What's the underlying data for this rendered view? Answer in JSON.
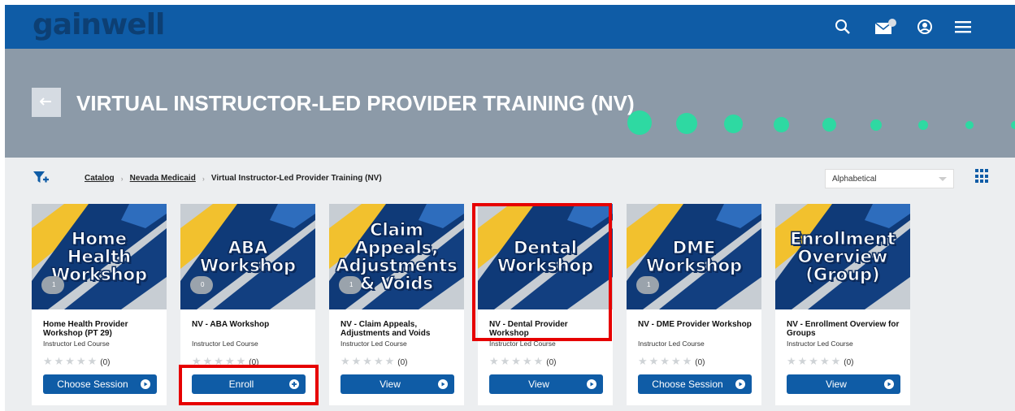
{
  "header": {
    "logo_text": "gainwell",
    "icons": [
      "search-icon",
      "messages-icon",
      "account-icon",
      "menu-icon"
    ],
    "brand_color": "#0f5ca6"
  },
  "banner": {
    "title": "VIRTUAL INSTRUCTOR-LED PROVIDER TRAINING (NV)"
  },
  "breadcrumb": {
    "items": [
      "Catalog",
      "Nevada Medicaid",
      "Virtual Instructor-Led Provider Training (NV)"
    ]
  },
  "sort": {
    "selected": "Alphabetical"
  },
  "cards": [
    {
      "image_lines": [
        "Home",
        "Health",
        "Workshop"
      ],
      "badge": "1",
      "title": "Home Health Provider Workshop (PT 29)",
      "type": "Instructor Led Course",
      "stars": "★★★★★",
      "rating_count": "(0)",
      "button": "Choose Session",
      "button_icon": "play-icon"
    },
    {
      "image_lines": [
        "ABA",
        "Workshop"
      ],
      "badge": "0",
      "title": "NV - ABA Workshop",
      "type": "Instructor Led Course",
      "stars": "★★★★★",
      "rating_count": "(0)",
      "button": "Enroll",
      "button_icon": "plus-icon"
    },
    {
      "image_lines": [
        "Claim",
        "Appeals,",
        "Adjustments",
        "& Voids"
      ],
      "badge": "1",
      "title": "NV - Claim Appeals, Adjustments and Voids",
      "type": "Instructor Led Course",
      "stars": "★★★★★",
      "rating_count": "(0)",
      "button": "View",
      "button_icon": "play-icon"
    },
    {
      "image_lines": [
        "Dental",
        "Workshop"
      ],
      "badge": "",
      "title": "NV - Dental Provider Workshop",
      "type": "Instructor Led Course",
      "stars": "★★★★★",
      "rating_count": "(0)",
      "button": "View",
      "button_icon": "play-icon"
    },
    {
      "image_lines": [
        "DME",
        "Workshop"
      ],
      "badge": "1",
      "title": "NV - DME Provider Workshop",
      "type": "Instructor Led Course",
      "stars": "★★★★★",
      "rating_count": "(0)",
      "button": "Choose Session",
      "button_icon": "play-icon"
    },
    {
      "image_lines": [
        "Enrollment",
        "Overview",
        "(Group)"
      ],
      "badge": "",
      "title": "NV - Enrollment Overview for Groups",
      "type": "Instructor Led Course",
      "stars": "★★★★★",
      "rating_count": "(0)",
      "button": "View",
      "button_icon": "play-icon"
    }
  ],
  "colors": {
    "banner": "#8c9aa8",
    "accent_dots": "#2ed9a2",
    "highlight": "#e60000"
  }
}
